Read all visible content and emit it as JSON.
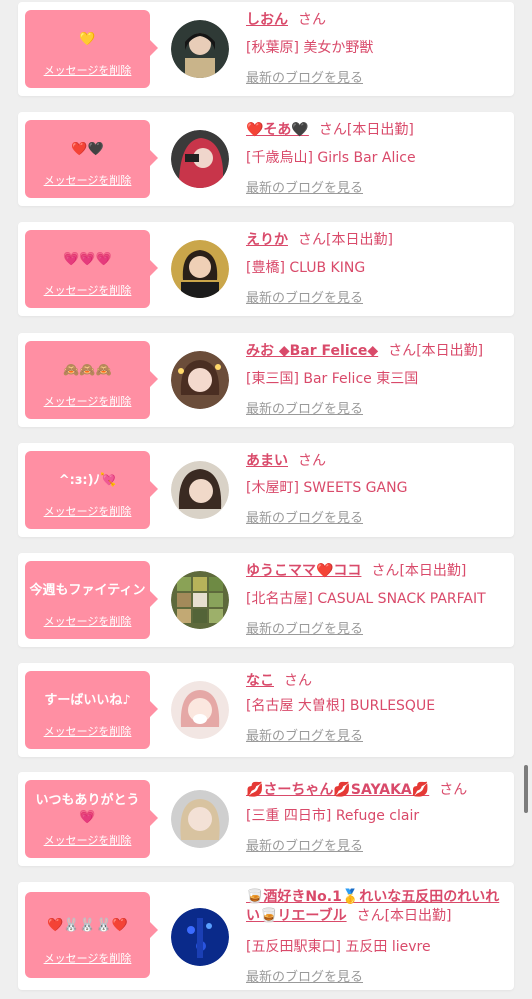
{
  "colors": {
    "bubble": "#ff8fa3",
    "name_text": "#d94a6a",
    "blog_link": "#9a9a9a",
    "background": "#efefef",
    "card": "#ffffff"
  },
  "delete_label": "メッセージを削除",
  "san_label": "さん",
  "blog_label": "最新のブログを見る",
  "items": [
    {
      "message": "💛",
      "name": "しおん",
      "suffix": "",
      "store": "[秋葉原] 美女か野獣",
      "avatar_icon": "avatar-photo"
    },
    {
      "message": "❤️🖤",
      "name": "❤️そあ🖤",
      "suffix": "[本日出勤]",
      "store": "[千歳烏山] Girls Bar Alice",
      "avatar_icon": "avatar-photo"
    },
    {
      "message": "💗💗💗",
      "name": "えりか",
      "suffix": "[本日出勤]",
      "store": "[豊橋] CLUB KING",
      "avatar_icon": "avatar-photo"
    },
    {
      "message": "🙈🙈🙈",
      "name": "みお ◆Bar Felice◆",
      "suffix": "[本日出勤]",
      "store": "[東三国] Bar Felice 東三国",
      "avatar_icon": "avatar-photo"
    },
    {
      "message": "^:з:)ﾉ💘",
      "name": "あまい",
      "suffix": "",
      "store": "[木屋町] SWEETS GANG",
      "avatar_icon": "avatar-photo"
    },
    {
      "message": "今週もファイティン",
      "name": "ゆうこママ❤️ココ",
      "suffix": "[本日出勤]",
      "store": "[北名古屋] CASUAL SNACK PARFAIT",
      "avatar_icon": "avatar-photo"
    },
    {
      "message": "すーばいいね♪",
      "name": "なこ",
      "suffix": "",
      "store": "[名古屋 大曽根] BURLESQUE",
      "avatar_icon": "avatar-photo"
    },
    {
      "message": "いつもありがとう💗",
      "name": "💋さーちゃん💋SAYAKA💋",
      "suffix": "",
      "store": "[三重 四日市] Refuge clair",
      "avatar_icon": "avatar-photo"
    },
    {
      "message": "❤️🐰🐰🐰❤️",
      "name": "🥃酒好きNo.1🥇れいな五反田のれいれい🥃リエーブル",
      "suffix": "[本日出勤]",
      "store": "[五反田駅東口] 五反田 lievre",
      "avatar_icon": "avatar-photo"
    }
  ]
}
